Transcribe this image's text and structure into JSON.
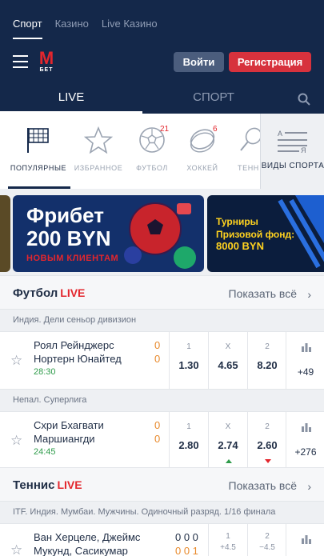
{
  "top_tabs": [
    "Спорт",
    "Казино",
    "Live Казино"
  ],
  "header": {
    "logo_m": "М",
    "logo_bet": "БЕТ",
    "login": "Войти",
    "register": "Регистрация"
  },
  "subnav": {
    "live": "LIVE",
    "sport": "СПОРТ"
  },
  "categories": [
    {
      "label": "ПОПУЛЯРНЫЕ",
      "icon": "flag-icon"
    },
    {
      "label": "ИЗБРАННОЕ",
      "icon": "star-icon"
    },
    {
      "label": "ФУТБОЛ",
      "icon": "football-icon",
      "badge": "21"
    },
    {
      "label": "ХОККЕЙ",
      "icon": "puck-icon",
      "badge": "6"
    },
    {
      "label": "ТЕНН",
      "icon": "tennis-icon"
    }
  ],
  "sport_types": "ВИДЫ СПОРТА",
  "banners": {
    "freebet_line1": "Фрибет",
    "freebet_line2": "200 BYN",
    "freebet_sub": "НОВЫМ КЛИЕНТАМ",
    "tournament_line1": "Турниры",
    "tournament_line2": "Призовой фонд:",
    "tournament_line3": "8000 BYN"
  },
  "football": {
    "name": "Футбол",
    "live": "LIVE",
    "show_all": "Показать всё",
    "leagues": [
      {
        "name": "Индия. Дели сеньор дивизион",
        "match": {
          "team1": "Роял Рейнджерс",
          "team2": "Нортерн Юнайтед",
          "score1": "0",
          "score2": "0",
          "time": "28:30",
          "h1": "1",
          "hx": "X",
          "h2": "2",
          "o1": "1.30",
          "ox": "4.65",
          "o2": "8.20",
          "more": "+49"
        }
      },
      {
        "name": "Непал. Суперлига",
        "match": {
          "team1": "Схри Бхагвати",
          "team2": "Маршиангди",
          "score1": "0",
          "score2": "0",
          "time": "24:45",
          "h1": "1",
          "hx": "X",
          "h2": "2",
          "o1": "2.80",
          "ox": "2.74",
          "o2": "2.60",
          "more": "+276"
        }
      }
    ]
  },
  "tennis": {
    "name": "Теннис",
    "live": "LIVE",
    "show_all": "Показать всё",
    "league": "ITF. Индия. Мумбаи. Мужчины. Одиночный разряд. 1/16 финала",
    "match": {
      "team1": "Ван Херцеле, Джеймс",
      "team2": "Мукунд, Сасикумар",
      "score1": "0 0 0",
      "score2": "0 0 1",
      "h1": "1",
      "h2": "2",
      "o1": "+4.5",
      "o2": "−4.5"
    }
  },
  "colors": {
    "navy": "#14284a",
    "red": "#d7323d",
    "live_red": "#e3262d",
    "green": "#2e9b4a",
    "score_orange": "#e8892b"
  }
}
